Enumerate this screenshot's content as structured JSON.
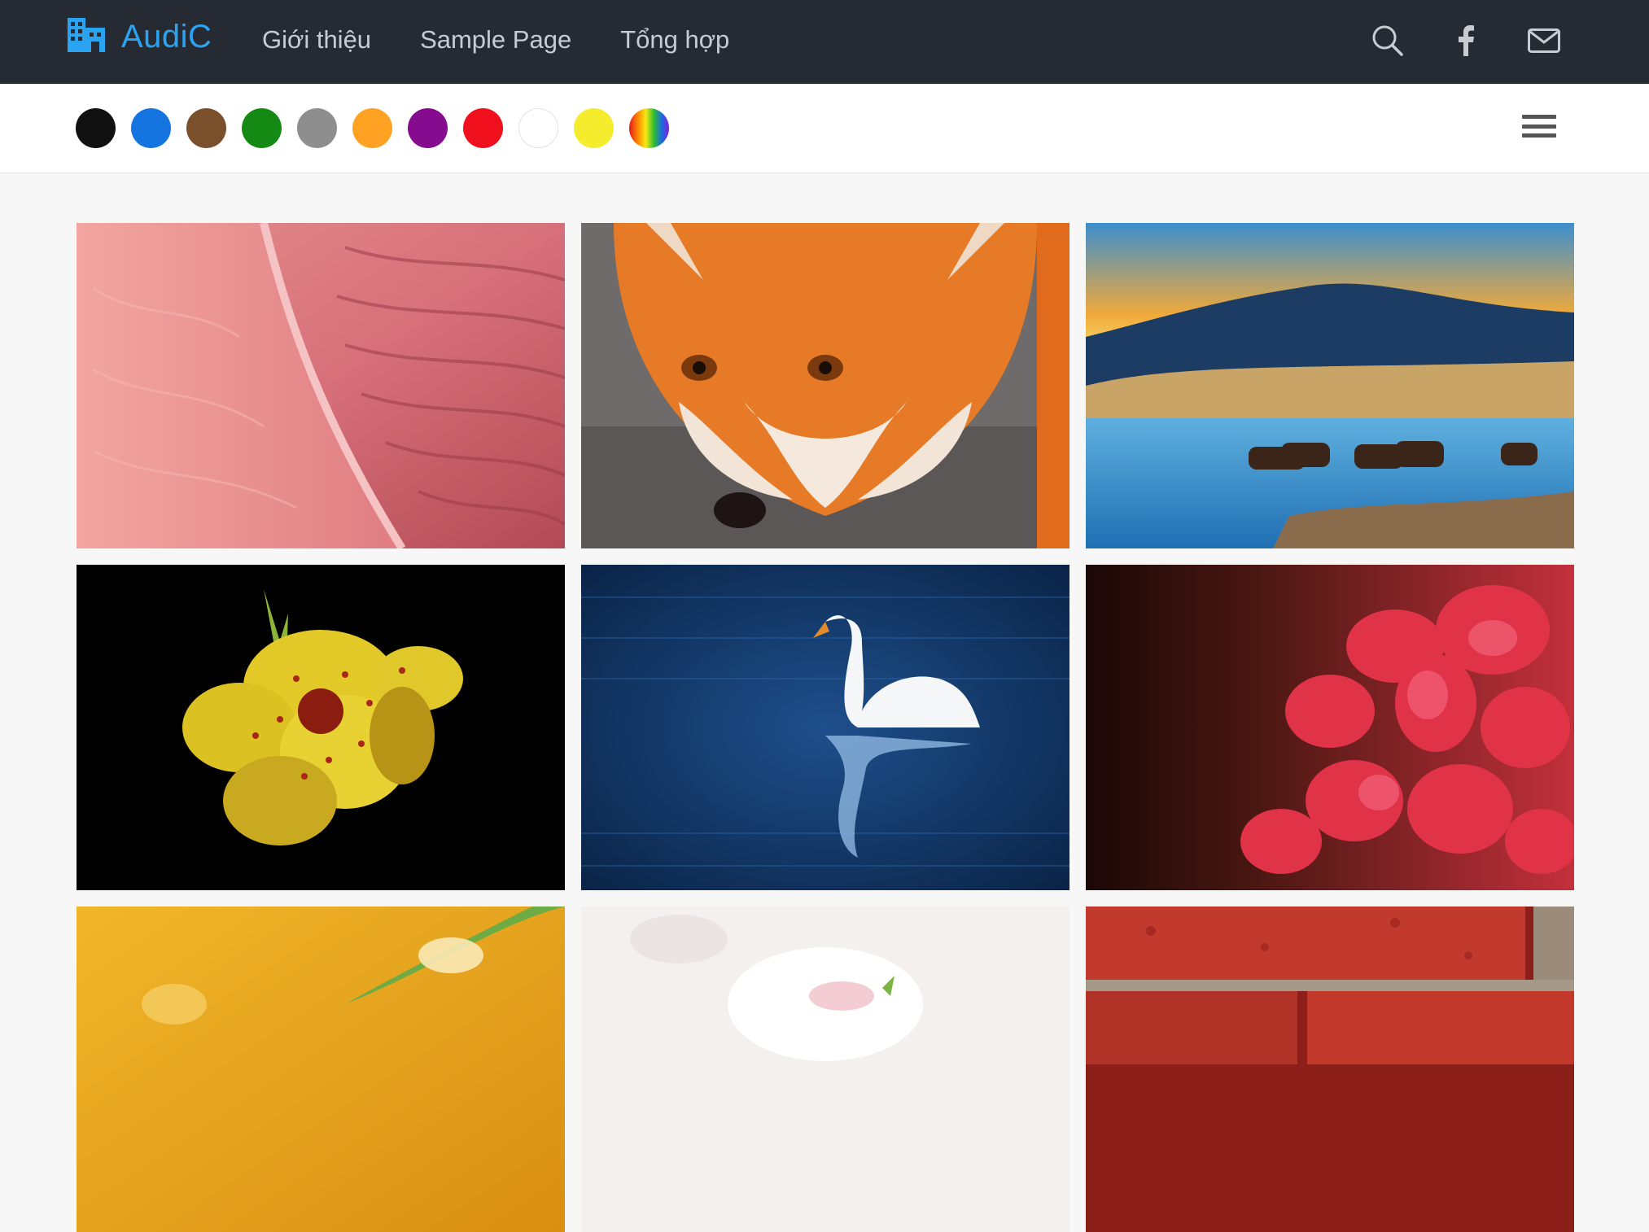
{
  "header": {
    "brand": "AudiC",
    "nav": [
      "Giới thiệu",
      "Sample Page",
      "Tổng hợp"
    ],
    "icons": [
      "search-icon",
      "facebook-icon",
      "mail-icon"
    ]
  },
  "colors": {
    "brand_accent": "#2aa3f0",
    "topbar_bg": "#262b33",
    "swatches": [
      "#111111",
      "#1575e0",
      "#7a4f2c",
      "#148a14",
      "#8e8e8e",
      "#ffa122",
      "#850c8e",
      "#f00f1c",
      "#ffffff",
      "#f4ec2c",
      "rainbow"
    ]
  },
  "gallery": {
    "images": [
      "rock-waves",
      "red-fox",
      "mountain-lake-horses",
      "yellow-flower",
      "white-swan",
      "red-petals",
      "yellow-leaf",
      "white-blossom",
      "red-brick"
    ]
  }
}
